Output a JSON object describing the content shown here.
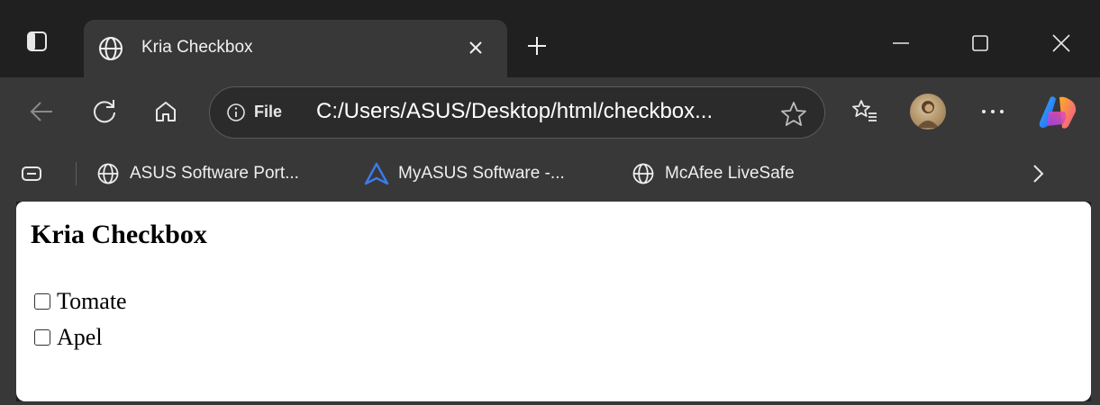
{
  "browser": {
    "tab": {
      "title": "Kria Checkbox",
      "icon": "globe-icon"
    },
    "address": {
      "scheme_label": "File",
      "url": "C:/Users/ASUS/Desktop/html/checkbox..."
    },
    "bookmarks": [
      {
        "label": "ASUS Software Port...",
        "icon": "globe-icon"
      },
      {
        "label": "MyASUS Software -...",
        "icon": "myasus-icon"
      },
      {
        "label": "McAfee LiveSafe",
        "icon": "globe-icon"
      }
    ]
  },
  "page": {
    "title": "Kria Checkbox",
    "options": [
      {
        "label": "Tomate",
        "checked": false
      },
      {
        "label": "Apel",
        "checked": false
      }
    ]
  },
  "colors": {
    "tabstrip_bg": "#202020",
    "toolbar_bg": "#383838",
    "page_bg": "#ffffff",
    "myasus_accent": "#3a7bf0"
  }
}
